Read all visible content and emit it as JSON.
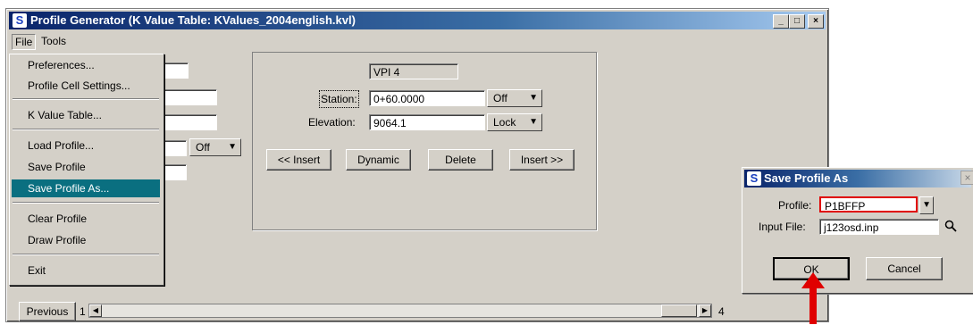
{
  "window": {
    "title": "Profile Generator  (K Value Table: KValues_2004english.kvl)",
    "logo": "S",
    "buttons": {
      "minimize": "_",
      "maximize": "□",
      "close": "×"
    }
  },
  "menubar": {
    "file": "File",
    "tools": "Tools"
  },
  "file_menu": {
    "items": [
      "Preferences...",
      "Profile Cell Settings...",
      "K Value Table...",
      "Load Profile...",
      "Save Profile",
      "Save Profile As...",
      "Clear Profile",
      "Draw Profile",
      "Exit"
    ]
  },
  "left_panel": {
    "off_combo": "Off"
  },
  "vpi_panel": {
    "vpi_label": "VPI 4",
    "station_label": "Station:",
    "station_value": "0+60.0000",
    "station_mode": "Off",
    "elevation_label": "Elevation:",
    "elevation_value": "9064.1",
    "elevation_mode": "Lock",
    "insert_before": "<< Insert",
    "dynamic": "Dynamic",
    "delete": "Delete",
    "insert_after": "Insert >>"
  },
  "bottom": {
    "previous": "Previous",
    "page_start": "1",
    "page_end": "4"
  },
  "dialog": {
    "title": "Save Profile As",
    "logo": "S",
    "profile_label": "Profile:",
    "profile_value": "P1BFFP",
    "input_file_label": "Input File:",
    "input_file_value": "j123osd.inp",
    "ok": "OK",
    "cancel": "Cancel"
  },
  "colors": {
    "menu_highlight": "#0a6f80",
    "title_blue": "#0a246a",
    "annotation_red": "#e00000"
  }
}
